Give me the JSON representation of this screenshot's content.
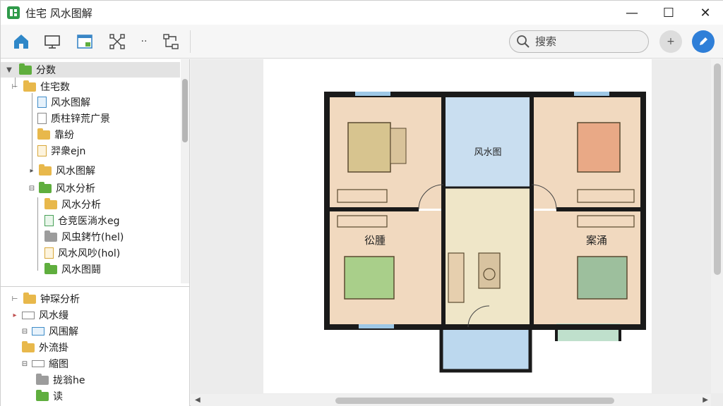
{
  "window": {
    "title": "住宅 风水图解",
    "minimize": "—",
    "maximize": "☐",
    "close": "✕"
  },
  "toolbar": {
    "icons": [
      "home-icon",
      "monitor-icon",
      "window-icon",
      "network-icon",
      "more-icon",
      "flow-icon"
    ],
    "more": "··",
    "search_placeholder": "搜索",
    "add_label": "+",
    "colors": {
      "home": "#2f87c8",
      "accent": "#2f7fd8"
    }
  },
  "tree": {
    "root": {
      "label": "分数",
      "expander": "▼"
    },
    "items": [
      {
        "label": "住宅数",
        "expander": "⊢",
        "icon": "folder-yellow"
      },
      {
        "label": "风水图解",
        "icon": "doc-blue"
      },
      {
        "label": "质柱锌荒广景",
        "icon": "doc"
      },
      {
        "label": "靠纷",
        "icon": "folder-yellow"
      },
      {
        "label": "羿衆ejn",
        "icon": "doc-yellow"
      },
      {
        "label": "风水图解",
        "expander": "▸",
        "icon": "folder-yellow"
      },
      {
        "label": "风水分析",
        "expander": "⊟",
        "icon": "folder-green"
      },
      {
        "label": "风水分析",
        "icon": "folder-yellow"
      },
      {
        "label": "仓竞医淌水eg",
        "icon": "doc-green"
      },
      {
        "label": "风虫銬竹(hel)",
        "icon": "folder-gray"
      },
      {
        "label": "风水风吵(hol)",
        "icon": "doc-yellow"
      },
      {
        "label": "风水图鬪",
        "icon": "folder-green"
      }
    ],
    "lower": [
      {
        "label": "钟琛分析",
        "expander": "⊢",
        "icon": "folder-yellow"
      },
      {
        "label": "风水缦",
        "expander": "▸",
        "icon": "window"
      },
      {
        "label": "风围解",
        "expander": "⊟",
        "icon": "window-blue"
      },
      {
        "label": "外流掛",
        "icon": "folder-yellow"
      },
      {
        "label": "縮图",
        "expander": "⊟",
        "icon": "window"
      },
      {
        "label": "拢翁he",
        "icon": "folder-gray"
      },
      {
        "label": "读",
        "icon": "folder-green"
      }
    ]
  },
  "floorplan": {
    "labels": [
      "风水图",
      "彸腫",
      "案涌"
    ],
    "colors": {
      "wall": "#1a1a1a",
      "floor": "#f1d9bf",
      "blue": "#bcd8ee",
      "corridor": "#efe6c8"
    }
  }
}
